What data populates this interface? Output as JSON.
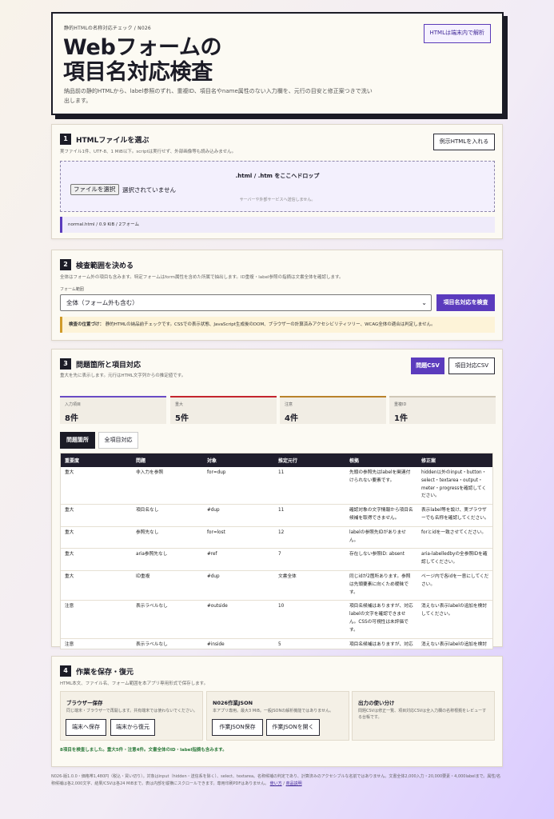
{
  "hero": {
    "eyebrow": "静的HTMLの名称対応チェック / N026",
    "title_line1": "Webフォームの",
    "title_line2": "項目名対応検査",
    "lead": "納品前の静的HTMLから、label参照のずれ、重複ID、項目名やname属性のない入力欄を、元行の目安と修正案つきで洗い出します。",
    "badge": "HTMLは端末内で解析"
  },
  "step1": {
    "num": "1",
    "title": "HTMLファイルを選ぶ",
    "desc": "実ファイル1件、UTF-8、1 MiB以下。scriptは実行せず、外部画像等も読み込みません。",
    "sample_button": "例示HTMLを入れる",
    "drop_title": ".html / .htm をここへドロップ",
    "file_button": "ファイルを選択",
    "file_status": "選択されていません",
    "drop_note": "サーバーや外部サービスへ送信しません。",
    "file_info": "normal.html / 0.9 KiB / 2フォーム"
  },
  "step2": {
    "num": "2",
    "title": "検査範囲を決める",
    "desc": "全体はフォーム外の項目も含みます。特定フォームはform属性を含めた所属で抽出します。ID重複・label参照の指摘は文書全体を確認します。",
    "scope_label": "フォーム範囲",
    "scope_value": "全体（フォーム外も含む）",
    "run_button": "項目名対応を検査",
    "note_strong": "検査の位置づけ：",
    "note_text": "静的HTMLの納品前チェックです。CSSでの表示状態、JavaScript生成後のDOM、ブラウザーの計算済みアクセシビリティツリー、WCAG全体の適合は判定しません。"
  },
  "step3": {
    "num": "3",
    "title": "問題箇所と項目対応",
    "desc": "重大を先に表示します。元行はHTML文字列からの推定値です。",
    "csv_issues": "問題CSV",
    "csv_fields": "項目対応CSV",
    "stats": [
      {
        "label": "入力項目",
        "value": "8件",
        "color": "#6a4bc4"
      },
      {
        "label": "重大",
        "value": "5件",
        "color": "#c4242d"
      },
      {
        "label": "注意",
        "value": "4件",
        "color": "#b9822a"
      },
      {
        "label": "重複ID",
        "value": "1件",
        "color": "#cfc7b6"
      }
    ],
    "tab_issues": "問題箇所",
    "tab_fields": "全項目対応",
    "columns": [
      "重要度",
      "問題",
      "対象",
      "推定元行",
      "根拠",
      "修正案"
    ],
    "rows": [
      {
        "sev": "重大",
        "issue": "非入力を参照",
        "target": "for=dup",
        "line": "11",
        "basis": "先頭の参照先はlabelを関連付けられない要素です。",
        "fix": "hidden以外のinput・button・select・textarea・output・meter・progressを確認してください。"
      },
      {
        "sev": "重大",
        "issue": "項目名なし",
        "target": "#dup",
        "line": "11",
        "basis": "確認対象の文字情報から項目名候補を取得できません。",
        "fix": "表示label等を設け、実ブラウザーでも名称を確認してください。"
      },
      {
        "sev": "重大",
        "issue": "参照先なし",
        "target": "for=lost",
        "line": "12",
        "basis": "labelの参照先IDがありません。",
        "fix": "forとidを一致させてください。"
      },
      {
        "sev": "重大",
        "issue": "aria参照先なし",
        "target": "#ref",
        "line": "7",
        "basis": "存在しない参照ID: absent",
        "fix": "aria-labelledbyの全参照IDを確認してください。"
      },
      {
        "sev": "重大",
        "issue": "ID重複",
        "target": "#dup",
        "line": "文書全体",
        "basis": "同じidが2箇所あります。参照は先頭要素に向くため曖昧です。",
        "fix": "ページ内で各idを一意にしてください。"
      },
      {
        "sev": "注意",
        "issue": "表示ラベルなし",
        "target": "#outside",
        "line": "10",
        "basis": "項目名候補はありますが、対応labelの文字を確認できません。CSSの可視性は未評価です。",
        "fix": "消えない表示labelの追加を検討してください。"
      },
      {
        "sev": "注意",
        "issue": "表示ラベルなし",
        "target": "#inside",
        "line": "5",
        "basis": "項目名候補はありますが、対応labelの文字を確認できません。",
        "fix": "消えない表示labelの追加を検討してください。"
      }
    ]
  },
  "step4": {
    "num": "4",
    "title": "作業を保存・復元",
    "desc": "HTML本文、ファイル名、フォーム範囲を本アプリ専用形式で保存します。",
    "card1_title": "ブラウザー保存",
    "card1_desc": "同じ端末・ブラウザーで再開します。共有端末では使わないでください。",
    "save_local": "端末へ保存",
    "restore_local": "端末から復元",
    "card2_title": "N026作業JSON",
    "card2_desc": "本アプリ専用。最大3 MiB。一般JSONの解析機能ではありません。",
    "save_json": "作業JSON保存",
    "open_json": "作業JSONを開く",
    "card3_title": "出力の使い分け",
    "card3_desc": "問題CSVは修正一覧、項目対応CSVは全入力欄の名称根拠をレビューする台帳です。",
    "status": "8項目を検査しました。重大5件・注意4件。文書全体のID・label指摘も含みます。"
  },
  "footer": {
    "text": "N026-版1.0.0・価格帯1,480円（税込・買い切り）。対象はinput（hidden・送信系を除く）、select、textarea。名称候補の判定であり、計算済みのアクセシブルな名前ではありません。文書全体2,000入力・20,000要素・4,000labelまで。属性/名称候補は各2,000文字、結果/CSVは各24 MiBまで。表は内部を縦横にスクロールできます。専用印刷PDFはありません。",
    "link_terms": "使い方",
    "sep": " / ",
    "link_product": "商品説明"
  },
  "colors": {
    "accent": "#5b3bbd",
    "critical": "#c4242d",
    "warning": "#a8741a",
    "ink": "#1b1b26"
  }
}
